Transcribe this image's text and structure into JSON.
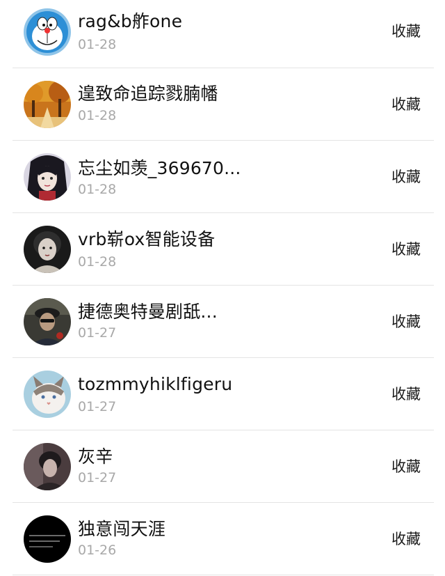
{
  "items": [
    {
      "name": "rag&b舴one",
      "date": "01-28",
      "action": "收藏",
      "avatar": "doraemon-avatar"
    },
    {
      "name": "遑致命追踪戮腩幡",
      "date": "01-28",
      "action": "收藏",
      "avatar": "autumn-forest-avatar"
    },
    {
      "name": "忘尘如羡_369670...",
      "date": "01-28",
      "action": "收藏",
      "avatar": "anime-character-avatar"
    },
    {
      "name": "vrb崭ox智能设备",
      "date": "01-28",
      "action": "收藏",
      "avatar": "woman-portrait-avatar"
    },
    {
      "name": "捷德奥特曼剧舐...",
      "date": "01-27",
      "action": "收藏",
      "avatar": "man-with-hat-avatar"
    },
    {
      "name": "tozmmyhiklfigeru",
      "date": "01-27",
      "action": "收藏",
      "avatar": "cat-avatar"
    },
    {
      "name": "灰辛",
      "date": "01-27",
      "action": "收藏",
      "avatar": "dark-portrait-avatar"
    },
    {
      "name": "独意闯天涯",
      "date": "01-26",
      "action": "收藏",
      "avatar": "black-text-avatar"
    }
  ]
}
